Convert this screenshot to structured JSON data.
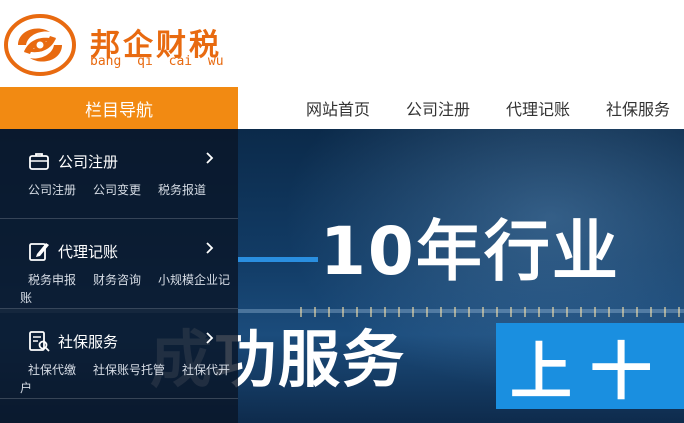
{
  "header": {
    "logo_cn": "邦企财税",
    "logo_pinyin": "bang qi cai wu"
  },
  "nav": {
    "toggle_label": "栏目导航",
    "links": [
      "网站首页",
      "公司注册",
      "代理记账",
      "社保服务"
    ]
  },
  "sidemenu": {
    "categories": [
      {
        "title": "公司注册",
        "icon": "briefcase-icon",
        "items": [
          "公司注册",
          "公司变更",
          "税务报道"
        ]
      },
      {
        "title": "代理记账",
        "icon": "edit-icon",
        "items": [
          "税务申报",
          "财务咨询",
          "小规模企业记账"
        ]
      },
      {
        "title": "社保服务",
        "icon": "document-search-icon",
        "items": [
          "社保代缴",
          "社保账号托管",
          "社保代开户"
        ]
      }
    ]
  },
  "banner": {
    "headline": "10年行业",
    "subline_faded": "成",
    "subline": "功服务",
    "highlight": "上十"
  },
  "colors": {
    "brand_orange": "#e86a10",
    "nav_orange": "#f28a12",
    "banner_blue": "#1a8fe0"
  }
}
